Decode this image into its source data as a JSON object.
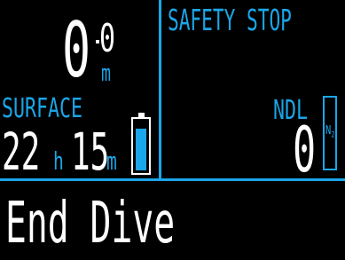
{
  "depth": {
    "integer": "0",
    "decimal": "0",
    "unit": "m"
  },
  "surface": {
    "label": "SURFACE",
    "hours": "22",
    "hours_unit": "h",
    "minutes": "15",
    "minutes_unit": "m"
  },
  "battery": {
    "level_fraction": 0.85
  },
  "safety_stop": {
    "label": "SAFETY STOP"
  },
  "ndl": {
    "label": "NDL",
    "value": "0"
  },
  "gas": {
    "main": "N",
    "sub": "2"
  },
  "menu": {
    "action_label": "End Dive"
  },
  "colors": {
    "accent": "#1aa6e8",
    "text": "#ffffff",
    "background": "#000000"
  }
}
